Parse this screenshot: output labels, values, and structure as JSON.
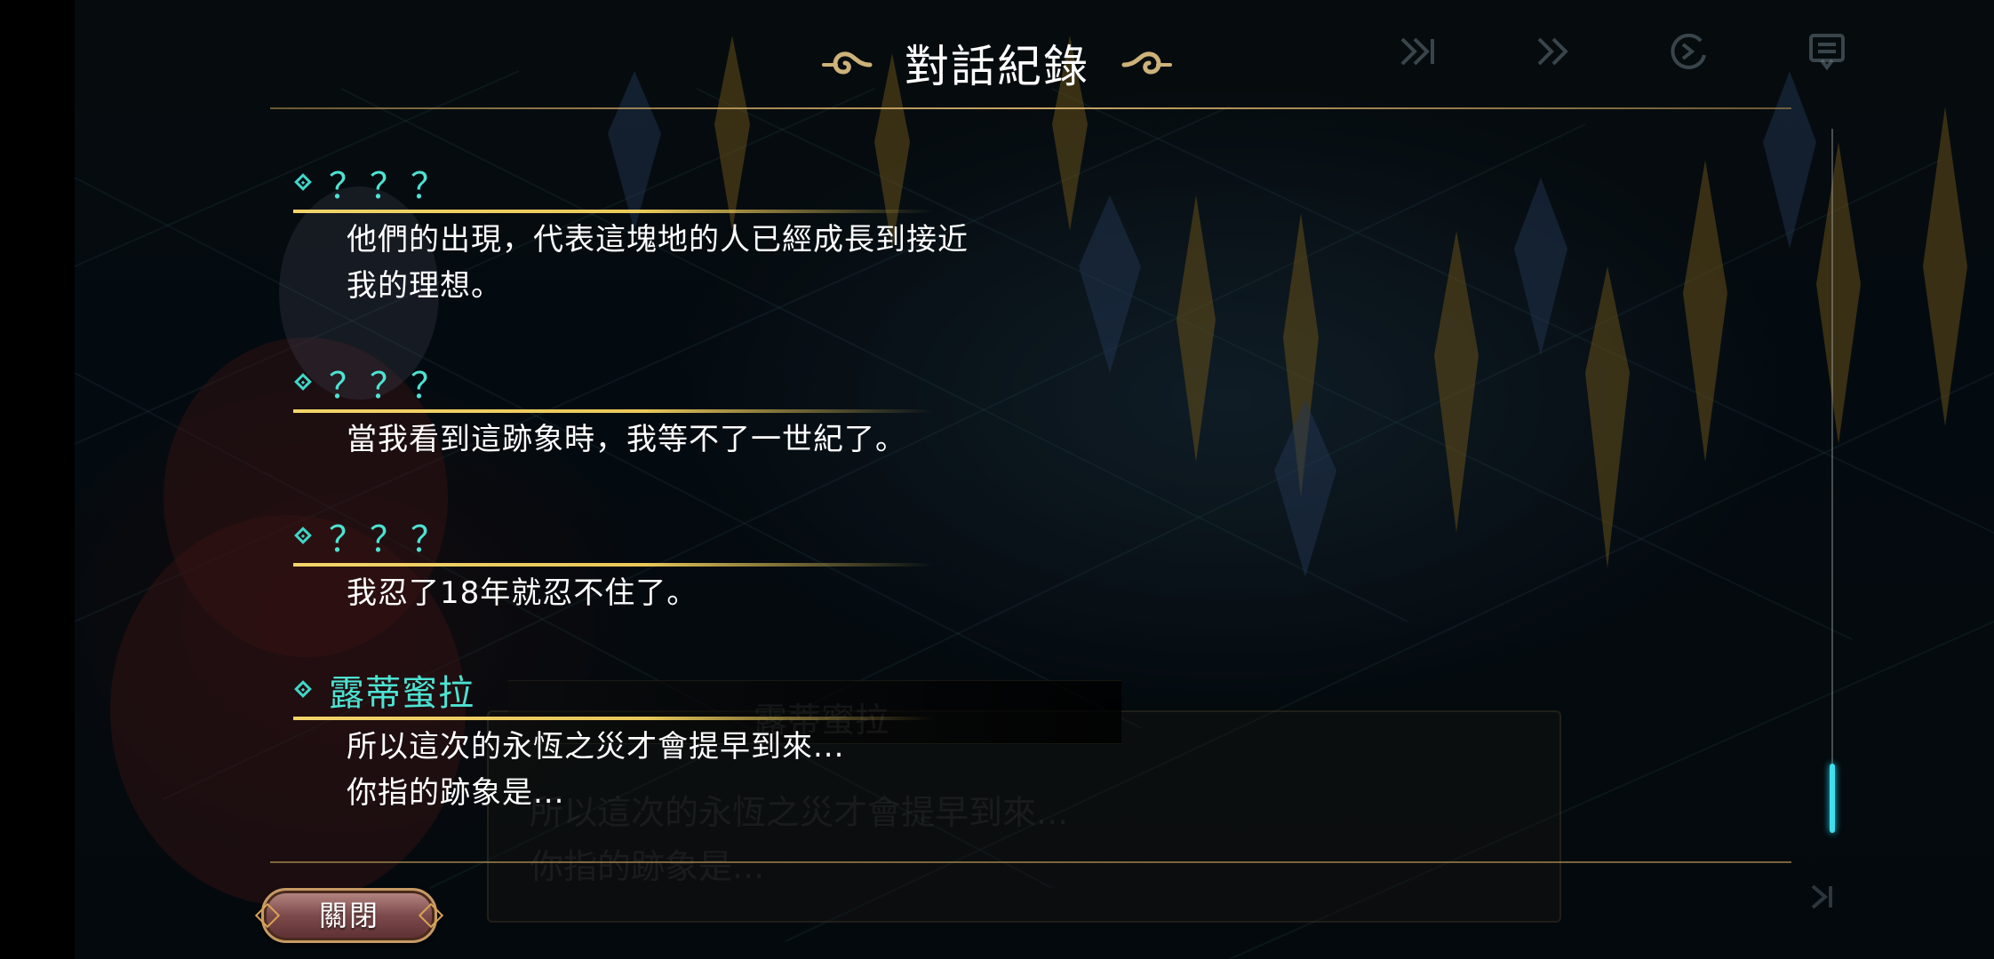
{
  "header": {
    "title": "對話紀錄"
  },
  "top_controls": {
    "skip_icon": "skip-forward-icon",
    "fast_forward_icon": "fast-forward-icon",
    "auto_icon": "auto-play-icon",
    "log_icon": "log-icon"
  },
  "entries": [
    {
      "speaker": "？？？",
      "lines": [
        "他們的出現，代表這塊地的人已經成長到接近",
        "我的理想。"
      ]
    },
    {
      "speaker": "？？？",
      "lines": [
        "當我看到這跡象時，我等不了一世紀了。"
      ]
    },
    {
      "speaker": "？？？",
      "lines": [
        "我忍了18年就忍不住了。"
      ]
    },
    {
      "speaker": "露蒂蜜拉",
      "lines": [
        "所以這次的永恆之災才會提早到來...",
        "你指的跡象是..."
      ]
    }
  ],
  "background_dialog": {
    "name": "露蒂蜜拉",
    "lines": [
      "所以這次的永恆之災才會提早到來...",
      "你指的跡象是..."
    ]
  },
  "footer": {
    "close_label": "關閉"
  },
  "colors": {
    "accent_cyan": "#4de3d3",
    "rule_gold": "#f3d46a",
    "scroll_thumb": "#3ee0f0"
  }
}
